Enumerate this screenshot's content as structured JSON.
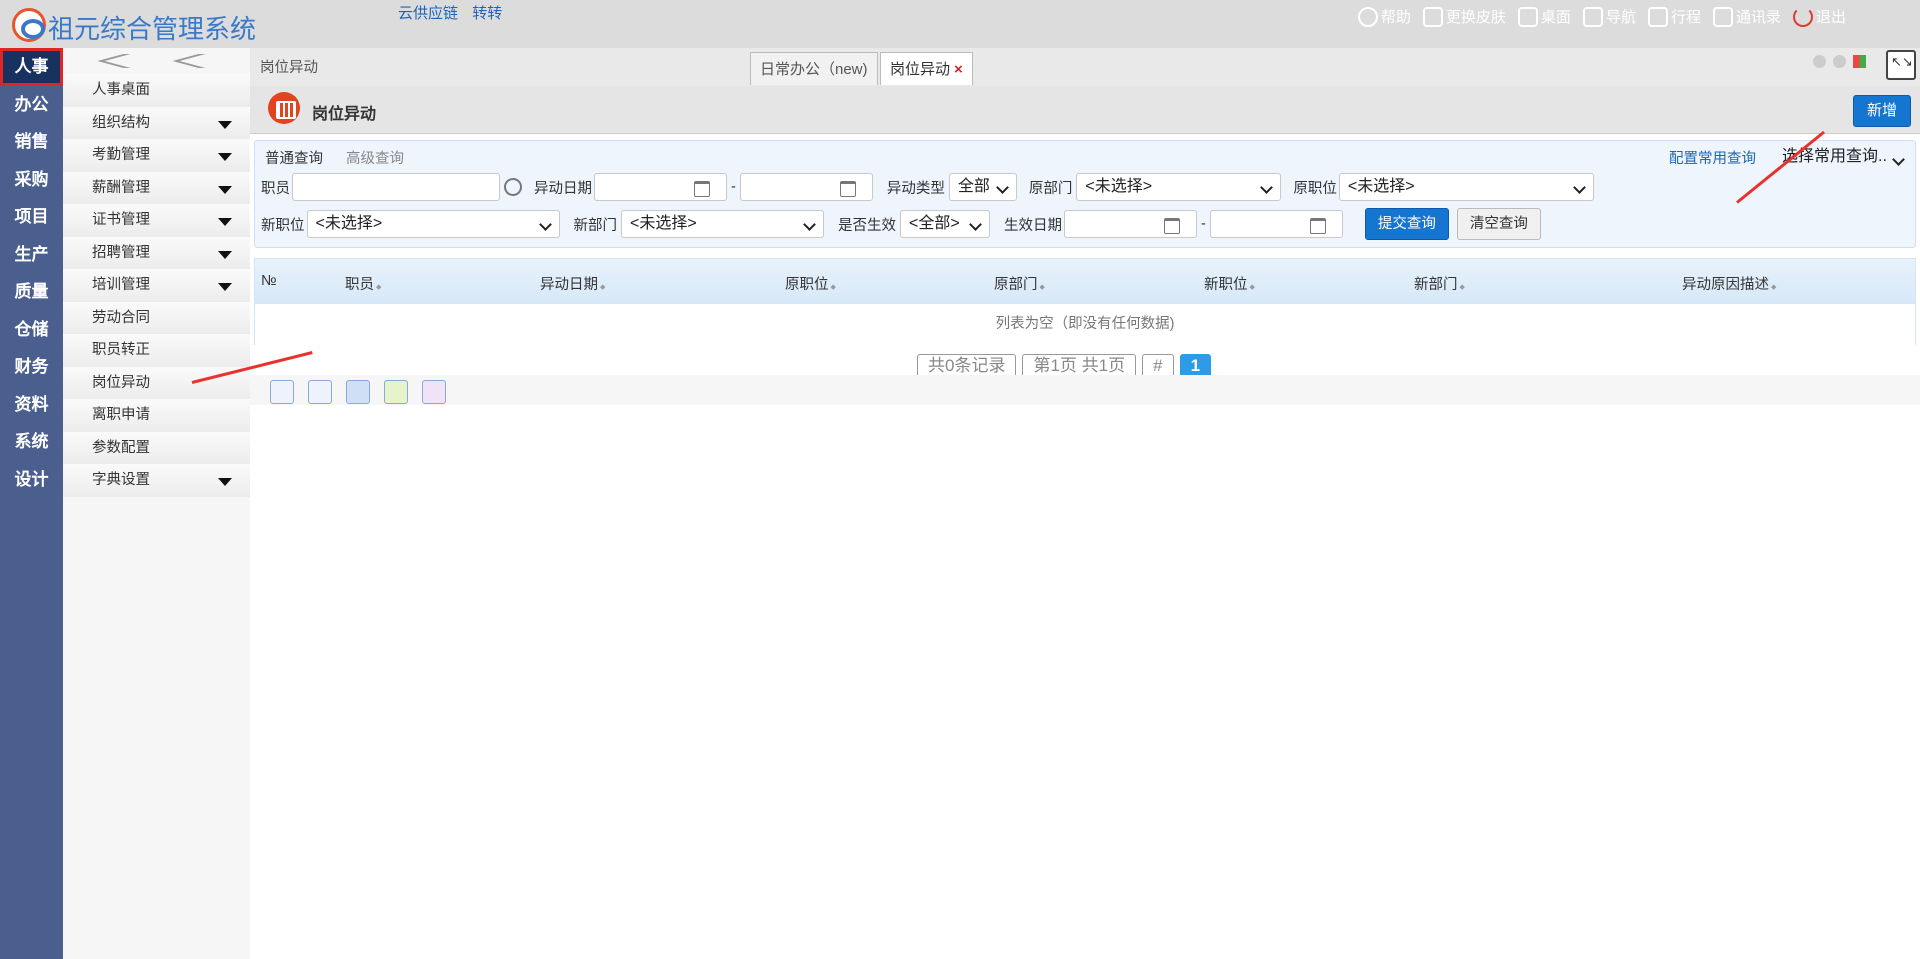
{
  "app": {
    "title": "祖元综合管理系统"
  },
  "quick_links": [
    "云供应链",
    "转转"
  ],
  "top_nav": [
    {
      "label": "帮助",
      "icon": "help-icon"
    },
    {
      "label": "更换皮肤",
      "icon": "shirt-icon"
    },
    {
      "label": "桌面",
      "icon": "home-icon"
    },
    {
      "label": "导航",
      "icon": "grid-icon"
    },
    {
      "label": "行程",
      "icon": "calendar-icon"
    },
    {
      "label": "通讯录",
      "icon": "contacts-icon"
    },
    {
      "label": "退出",
      "icon": "power-icon"
    }
  ],
  "left_nav": [
    "人事",
    "办公",
    "销售",
    "采购",
    "项目",
    "生产",
    "质量",
    "仓储",
    "财务",
    "资料",
    "系统",
    "设计"
  ],
  "left_nav_active": "人事",
  "submenu": [
    {
      "label": "人事桌面",
      "expandable": false
    },
    {
      "label": "组织结构",
      "expandable": true
    },
    {
      "label": "考勤管理",
      "expandable": true
    },
    {
      "label": "薪酬管理",
      "expandable": true
    },
    {
      "label": "证书管理",
      "expandable": true
    },
    {
      "label": "招聘管理",
      "expandable": true
    },
    {
      "label": "培训管理",
      "expandable": true
    },
    {
      "label": "劳动合同",
      "expandable": false
    },
    {
      "label": "职员转正",
      "expandable": false
    },
    {
      "label": "岗位异动",
      "expandable": false
    },
    {
      "label": "离职申请",
      "expandable": false
    },
    {
      "label": "参数配置",
      "expandable": false
    },
    {
      "label": "字典设置",
      "expandable": true
    }
  ],
  "breadcrumb": "岗位异动",
  "tabs": [
    {
      "label": "日常办公（new)",
      "active": false
    },
    {
      "label": "岗位异动",
      "active": true
    }
  ],
  "page": {
    "title": "岗位异动",
    "add_button": "新增"
  },
  "query": {
    "tab_normal": "普通查询",
    "tab_advanced": "高级查询",
    "config_link": "配置常用查询",
    "common_select": "选择常用查询..",
    "employee_label": "职员",
    "change_date_label": "异动日期",
    "range_sep": "-",
    "change_type_label": "异动类型",
    "change_type_value": "全部",
    "old_dept_label": "原部门",
    "old_dept_value": "<未选择>",
    "old_pos_label": "原职位",
    "old_pos_value": "<未选择>",
    "new_pos_label": "新职位",
    "new_pos_value": "<未选择>",
    "new_dept_label": "新部门",
    "new_dept_value": "<未选择>",
    "effective_label": "是否生效",
    "effective_value": "<全部>",
    "effective_date_label": "生效日期",
    "submit_button": "提交查询",
    "clear_button": "清空查询"
  },
  "grid": {
    "columns": [
      "№",
      "职员",
      "异动日期",
      "原职位",
      "原部门",
      "新职位",
      "新部门",
      "异动原因描述"
    ],
    "sort_mark": "◆",
    "empty_text": "列表为空（即没有任何数据)"
  },
  "pager": {
    "records": "共0条记录",
    "pages": "第1页 共1页",
    "hash": "#",
    "current": "1"
  },
  "colors": {
    "accent": "#1476d1",
    "leftnav": "#4a5f8e",
    "annotation": "#e8322e"
  }
}
